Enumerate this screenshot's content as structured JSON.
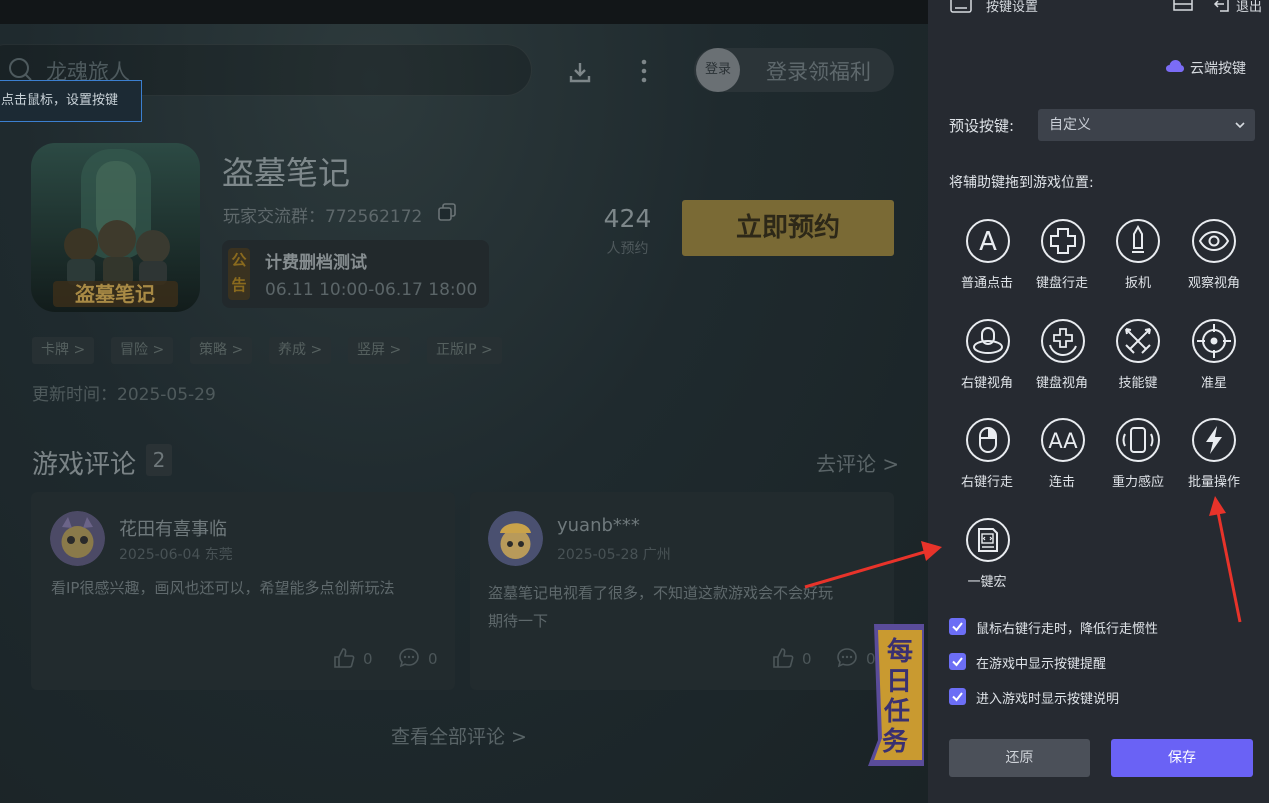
{
  "game_page": {
    "search_placeholder": "龙魂旅人",
    "tooltip": "点击鼠标，设置按键",
    "login_avatar": "登录",
    "login_text": "登录领福利",
    "title": "盗墓笔记",
    "group_text": "玩家交流群：772562172",
    "notice": {
      "tag": "公告",
      "title": "计费删档测试",
      "time": "06.11 10:00-06.17 18:00"
    },
    "reservation_count": "424",
    "reservation_label": "人预约",
    "reserve_button": "立即预约",
    "tags": [
      "卡牌 >",
      "冒险 >",
      "策略 >",
      "养成 >",
      "竖屏 >",
      "正版IP >"
    ],
    "update_time": "更新时间：2025-05-29",
    "reviews_title": "游戏评论",
    "reviews_count": "2",
    "go_review": "去评论 >",
    "reviews": [
      {
        "user": "花田有喜事临",
        "date": "2025-06-04 东莞",
        "text": "看IP很感兴趣，画风也还可以，希望能多点创新玩法",
        "likes": "0",
        "comments": "0"
      },
      {
        "user": "yuanb***",
        "date": "2025-05-28 广州",
        "text_line1": "盗墓笔记电视看了很多，不知道这款游戏会不会好玩",
        "text_line2": "期待一下",
        "likes": "0",
        "comments": "0"
      }
    ],
    "all_reviews": "查看全部评论 >",
    "daily_task_text": "每日任务"
  },
  "panel": {
    "title": "按键设置",
    "exit": "退出",
    "cloud_keys": "云端按键",
    "preset_label": "预设按键:",
    "preset_value": "自定义",
    "drag_hint": "将辅助键拖到游戏位置:",
    "keys": [
      {
        "label": "普通点击",
        "icon": "letter-a-icon"
      },
      {
        "label": "键盘行走",
        "icon": "dpad-cross-icon"
      },
      {
        "label": "扳机",
        "icon": "trigger-icon"
      },
      {
        "label": "观察视角",
        "icon": "eye-icon"
      },
      {
        "label": "右键视角",
        "icon": "mouse-rotate-icon"
      },
      {
        "label": "键盘视角",
        "icon": "keyboard-rotate-icon"
      },
      {
        "label": "技能键",
        "icon": "crossed-swords-icon"
      },
      {
        "label": "准星",
        "icon": "crosshair-icon"
      },
      {
        "label": "右键行走",
        "icon": "mouse-icon"
      },
      {
        "label": "连击",
        "icon": "double-a-icon"
      },
      {
        "label": "重力感应",
        "icon": "phone-tilt-icon"
      },
      {
        "label": "批量操作",
        "icon": "lightning-icon"
      },
      {
        "label": "一键宏",
        "icon": "script-icon"
      }
    ],
    "options": [
      {
        "label": "鼠标右键行走时，降低行走惯性",
        "checked": true
      },
      {
        "label": "在游戏中显示按键提醒",
        "checked": true
      },
      {
        "label": "进入游戏时显示按键说明",
        "checked": true
      }
    ],
    "restore_button": "还原",
    "save_button": "保存"
  },
  "colors": {
    "accent": "#6a62f5",
    "annotation_arrow": "#e8332a",
    "reserve_gold": "#7a6a35"
  }
}
